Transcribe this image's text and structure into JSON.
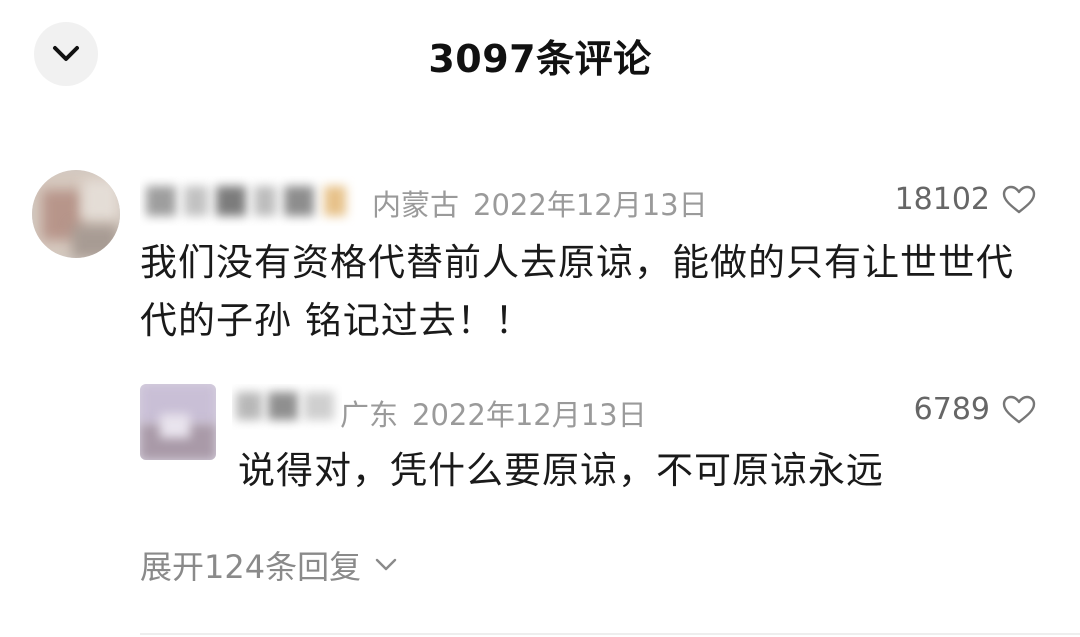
{
  "header": {
    "title": "3097条评论",
    "collapse_icon": "chevron-down-icon"
  },
  "comment": {
    "location": "内蒙古",
    "date": "2022年12月13日",
    "likes": "18102",
    "text": "我们没有资格代替前人去原谅，能做的只有让世世代代的子孙 铭记过去！！",
    "like_icon": "heart-outline-icon"
  },
  "reply": {
    "location": "广东",
    "date": "2022年12月13日",
    "likes": "6789",
    "text": "说得对，凭什么要原谅，不可原谅永远",
    "like_icon": "heart-outline-icon"
  },
  "expand": {
    "label": "展开124条回复",
    "icon": "chevron-down-icon"
  },
  "colors": {
    "meta_gray": "#9a9a9a",
    "text": "#1a1a1a",
    "button_bg": "#f1f1f1"
  }
}
